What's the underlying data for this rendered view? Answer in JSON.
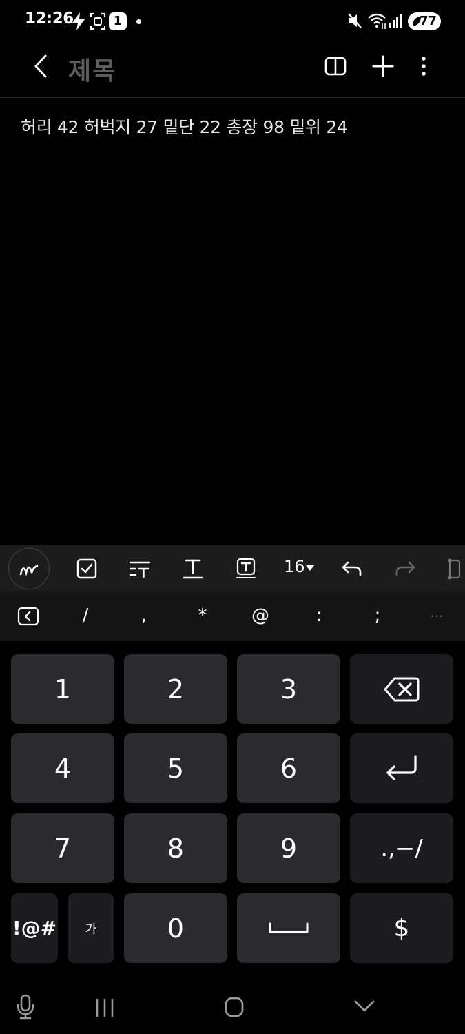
{
  "status_bar": {
    "time": "12:26",
    "sim_badge": "1",
    "battery": "77",
    "icons": [
      "bolt-icon",
      "screen-capture-icon",
      "sim-badge",
      "notification-dot",
      "mute-icon",
      "wifi-icon",
      "signal-icon",
      "battery-icon"
    ]
  },
  "app_bar": {
    "title": "제목",
    "icons": [
      "back-icon",
      "reader-mode-icon",
      "add-icon",
      "more-icon"
    ]
  },
  "note": {
    "body": "허리 42 허벅지 27 밑단 22 총장 98 밑위 24"
  },
  "format_toolbar": {
    "font_size": "16",
    "icons": [
      "pen-icon",
      "checkbox-icon",
      "text-style-icon",
      "underline-text-icon",
      "text-box-icon",
      "font-size-dropdown-icon",
      "undo-icon",
      "redo-icon",
      "more-tools-icon"
    ]
  },
  "symbol_row": {
    "symbols": [
      "/",
      ",",
      "*",
      "@",
      ":",
      ";"
    ],
    "ellipsis": "···"
  },
  "keyboard": {
    "rows": [
      [
        "1",
        "2",
        "3"
      ],
      [
        "4",
        "5",
        "6"
      ],
      [
        "7",
        "8",
        "9"
      ]
    ],
    "punct_key": ".,−/",
    "symbols_key": "!@#",
    "lang_key": "가",
    "zero_key": "0",
    "currency_key": "$"
  },
  "nav_bar": {
    "icons": [
      "mic-icon",
      "recent-apps-icon",
      "home-icon",
      "hide-keyboard-icon"
    ]
  },
  "colors": {
    "background": "#000000",
    "toolbar": "#1c1c1c",
    "key": "#2b2b2e",
    "title_gray": "#5c5c5c"
  }
}
